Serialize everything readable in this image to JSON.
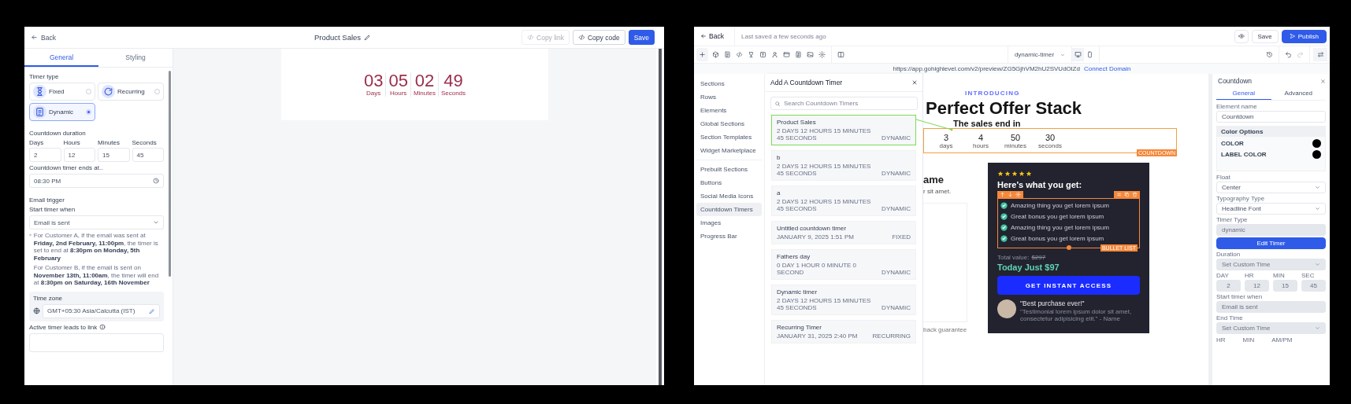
{
  "editor": {
    "back": "Back",
    "title": "Product Sales",
    "actions": [
      {
        "label": "Copy link",
        "kind": "outline",
        "disabled": true
      },
      {
        "label": "Copy code",
        "kind": "outline",
        "disabled": false
      },
      {
        "label": "Save",
        "kind": "primary",
        "disabled": false
      }
    ],
    "tabs": [
      {
        "label": "General",
        "selected": true
      },
      {
        "label": "Styling",
        "selected": false
      }
    ],
    "timer_type": {
      "label": "Timer type",
      "options": [
        {
          "label": "Fixed",
          "selected": false
        },
        {
          "label": "Recurring",
          "selected": false
        },
        {
          "label": "Dynamic",
          "selected": true
        }
      ]
    },
    "duration": {
      "label": "Countdown duration",
      "fields": [
        {
          "label": "Days",
          "value": "2"
        },
        {
          "label": "Hours",
          "value": "12"
        },
        {
          "label": "Minutes",
          "value": "15"
        },
        {
          "label": "Seconds",
          "value": "45"
        }
      ]
    },
    "ends_at": {
      "label": "Countdown timer ends at..",
      "value": "08:30 PM"
    },
    "email_trigger": {
      "label": "Email trigger",
      "start_label": "Start timer when",
      "value": "Email is sent",
      "notes": [
        "For Customer A, if the email was sent at **Friday, 2nd February, 11:00pm**, the timer is set to end at **8:30pm on Monday, 5th February**",
        "For Customer B, if the email is sent on **November 13th, 11:00am**, the timer will end at **8:30pm on Saturday, 16th November**"
      ]
    },
    "time_zone": {
      "label": "Time zone",
      "value": "GMT+05:30 Asia/Calcutta (IST)"
    },
    "link": {
      "label": "Active timer leads to link"
    },
    "preview": {
      "units": [
        {
          "value": "03",
          "label": "Days"
        },
        {
          "value": "05",
          "label": "Hours"
        },
        {
          "value": "02",
          "label": "Minutes"
        },
        {
          "value": "49",
          "label": "Seconds"
        }
      ]
    }
  },
  "builder": {
    "back": "Back",
    "saved": "Last saved a few seconds ago",
    "actions": [
      {
        "label": "Save",
        "kind": "outline"
      },
      {
        "label": "Publish",
        "kind": "primary"
      }
    ],
    "page_select": "dynamic-timer",
    "url": "https://app.gohighlevel.com/v2/preview/ZG5GjhVM2hU2SVUdOlZd",
    "connect": "Connect Domain",
    "nav_groups": [
      [
        {
          "label": "Sections",
          "selected": false
        },
        {
          "label": "Rows",
          "selected": false
        },
        {
          "label": "Elements",
          "selected": false
        },
        {
          "label": "Global Sections",
          "selected": false
        },
        {
          "label": "Section Templates",
          "selected": false
        },
        {
          "label": "Widget Marketplace",
          "selected": false
        }
      ],
      [
        {
          "label": "Prebuilt Sections",
          "selected": false
        },
        {
          "label": "Buttons",
          "selected": false
        },
        {
          "label": "Social Media Icons",
          "selected": false
        },
        {
          "label": "Countdown Timers",
          "selected": true
        },
        {
          "label": "Images",
          "selected": false
        },
        {
          "label": "Progress Bar",
          "selected": false
        }
      ]
    ],
    "picker": {
      "title": "Add A Countdown Timer",
      "placeholder": "Search Countdown Timers",
      "timers": [
        {
          "name": "Product Sales",
          "detail": "2 DAYS 12 HOURS 15 MINUTES 45 SECONDS",
          "type": "DYNAMIC",
          "selected": true
        },
        {
          "name": "b",
          "detail": "2 DAYS 12 HOURS 15 MINUTES 45 SECONDS",
          "type": "DYNAMIC",
          "selected": false
        },
        {
          "name": "a",
          "detail": "2 DAYS 12 HOURS 15 MINUTES 45 SECONDS",
          "type": "DYNAMIC",
          "selected": false
        },
        {
          "name": "Untitled countdown timer",
          "detail": "JANUARY 9, 2025 1:51 PM",
          "type": "FIXED",
          "selected": false
        },
        {
          "name": "Fathers day",
          "detail": "0 DAY 1 HOUR 0 MINUTE 0 SECOND",
          "type": "DYNAMIC",
          "selected": false
        },
        {
          "name": "Dynamic timer",
          "detail": "2 DAYS 12 HOURS 15 MINUTES 45 SECONDS",
          "type": "DYNAMIC",
          "selected": false
        },
        {
          "name": "Recurring Timer",
          "detail": "JANUARY 31, 2025 2:40 PM",
          "type": "RECURRING",
          "selected": false
        }
      ]
    },
    "page": {
      "eyebrow": "INTRODUCING",
      "headline": "Perfect Offer Stack",
      "subhead": "The sales end in",
      "countdown": [
        {
          "value": "3",
          "label": "days"
        },
        {
          "value": "4",
          "label": "hours"
        },
        {
          "value": "50",
          "label": "minutes"
        },
        {
          "value": "30",
          "label": "seconds"
        }
      ],
      "countdown_tag": "COUNTDOWN",
      "fragment_title": "ame",
      "fragment_text": "r sit amet.",
      "fragment_footer": "back guarantee",
      "offer": {
        "stars": 5,
        "heading": "Here's what you get:",
        "bullets": [
          "Amazing thing you get lorem ipsum",
          "Great bonus you get lorem ipsum",
          "Amazing thing you get lorem ipsum",
          "Great bonus you get lorem ipsum"
        ],
        "bullets_tag": "BULLET LIST",
        "total_label": "Total value:",
        "total_price": "$297",
        "today": "Today Just $97",
        "cta": "GET INSTANT ACCESS",
        "quote": "\"Best purchase ever!\"",
        "testimonial": "\"Testimonial lorem ipsum dolor sit amet, consectetur adipisicing elit.\" - Name"
      }
    },
    "settings": {
      "title": "Countdown",
      "tabs": [
        {
          "label": "General",
          "selected": true
        },
        {
          "label": "Advanced",
          "selected": false
        }
      ],
      "element_name_label": "Element name",
      "element_name": "Countdown",
      "color_options": {
        "title": "Color Options",
        "colors": [
          {
            "label": "COLOR",
            "color": "#000000"
          },
          {
            "label": "LABEL COLOR",
            "color": "#000000"
          }
        ]
      },
      "fields": [
        {
          "label": "Float",
          "value": "Center",
          "kind": "select",
          "disabled": false
        },
        {
          "label": "Typography Type",
          "value": "Headline Font",
          "kind": "select",
          "disabled": false
        },
        {
          "label": "Timer Type",
          "value": "dynamic",
          "kind": "text",
          "disabled": true
        }
      ],
      "edit": "Edit Timer",
      "duration": {
        "label": "Duration",
        "value": "Set Custom Time",
        "disabled": true
      },
      "parts": [
        {
          "label": "DAY",
          "value": "2",
          "disabled": true
        },
        {
          "label": "HR",
          "value": "12",
          "disabled": true
        },
        {
          "label": "MIN",
          "value": "15",
          "disabled": true
        },
        {
          "label": "SEC",
          "value": "45",
          "disabled": true
        }
      ],
      "start": {
        "label": "Start timer when",
        "value": "Email is sent",
        "disabled": true
      },
      "end": {
        "label": "End Time",
        "value": "Set Custom Time",
        "disabled": true
      },
      "time_labels": [
        "HR",
        "MIN",
        "AM/PM"
      ]
    }
  }
}
